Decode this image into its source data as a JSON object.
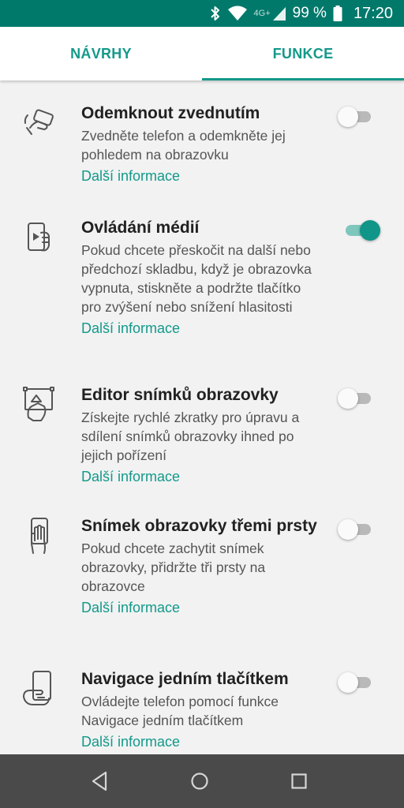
{
  "status_bar": {
    "network": "4G+",
    "battery": "99 %",
    "time": "17:20",
    "icons": [
      "bluetooth-icon",
      "wifi-icon",
      "signal-icon",
      "battery-icon"
    ]
  },
  "tabs": [
    {
      "label": "NÁVRHY",
      "selected": false
    },
    {
      "label": "FUNKCE",
      "selected": true
    }
  ],
  "colors": {
    "accent": "#13998a",
    "status_bar": "#00796b",
    "toggle_on": "#0f9688",
    "navbar": "#4a4a4a"
  },
  "features": [
    {
      "icon": "lift-unlock-icon",
      "title": "Odemknout zvednutím",
      "description": "Zvedněte telefon a odemkněte jej pohledem na obrazovku",
      "link": "Další informace",
      "enabled": false
    },
    {
      "icon": "media-control-icon",
      "title": "Ovládání médií",
      "description": "Pokud chcete přeskočit na další nebo předchozí skladbu, když je obrazovka vypnuta, stiskněte a podržte tlačítko pro zvýšení nebo snížení hlasitosti",
      "link": "Další informace",
      "enabled": true
    },
    {
      "icon": "screenshot-editor-icon",
      "title": "Editor snímků obrazovky",
      "description": "Získejte rychlé zkratky pro úpravu a sdílení snímků obrazovky ihned po jejich pořízení",
      "link": "Další informace",
      "enabled": false
    },
    {
      "icon": "three-finger-screenshot-icon",
      "title": "Snímek obrazovky třemi prsty",
      "description": "Pokud chcete zachytit snímek obrazovky, přidržte tři prsty na obrazovce",
      "link": "Další informace",
      "enabled": false
    },
    {
      "icon": "one-button-nav-icon",
      "title": "Navigace jedním tlačítkem",
      "description": "Ovládejte telefon pomocí funkce Navigace jedním tlačítkem",
      "link": "Další informace",
      "enabled": false
    }
  ],
  "nav_bar": [
    "back-icon",
    "home-icon",
    "recents-icon"
  ]
}
